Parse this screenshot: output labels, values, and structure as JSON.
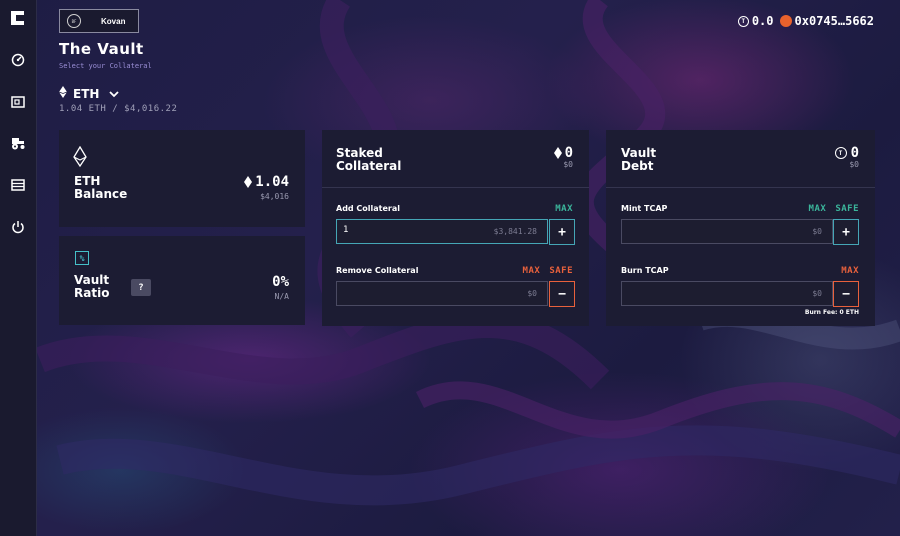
{
  "network": {
    "badge": "BF",
    "name": "Kovan"
  },
  "wallet": {
    "tcap_balance": "0.0",
    "address": "0x0745…5662"
  },
  "header": {
    "title": "The Vault",
    "subtitle": "Select your Collateral"
  },
  "collateral": {
    "selected": "ETH",
    "price_line": "1.04 ETH / $4,016.22"
  },
  "balance_card": {
    "label_line1": "ETH",
    "label_line2": "Balance",
    "amount": "1.04",
    "usd": "$4,016"
  },
  "ratio_card": {
    "label_line1": "Vault",
    "label_line2": "Ratio",
    "help": "?",
    "value": "0%",
    "sub": "N/A"
  },
  "staked_card": {
    "label_line1": "Staked",
    "label_line2": "Collateral",
    "amount": "0",
    "usd": "$0",
    "add_label": "Add Collateral",
    "add_max": "MAX",
    "add_value": "1",
    "add_usd": "$3,841.28",
    "add_button": "+",
    "remove_label": "Remove Collateral",
    "remove_max": "MAX",
    "remove_safe": "SAFE",
    "remove_usd": "$0",
    "remove_button": "−"
  },
  "debt_card": {
    "label_line1": "Vault",
    "label_line2": "Debt",
    "amount": "0",
    "usd": "$0",
    "mint_label": "Mint TCAP",
    "mint_max": "MAX",
    "mint_safe": "SAFE",
    "mint_usd": "$0",
    "mint_button": "+",
    "burn_label": "Burn TCAP",
    "burn_max": "MAX",
    "burn_usd": "$0",
    "burn_button": "−",
    "burn_fee": "Burn Fee: 0 ETH"
  },
  "colors": {
    "accent_teal": "#45a6b6",
    "safe_green": "#3bb59b",
    "warning_orange": "#e8613c",
    "wallet_dot": "#e8622c"
  },
  "icons": [
    "app-logo-icon",
    "dashboard-icon",
    "vault-icon",
    "farm-icon",
    "pools-icon",
    "logout-icon",
    "eth-icon",
    "chevron-down-icon",
    "tcap-icon",
    "percent-icon"
  ]
}
